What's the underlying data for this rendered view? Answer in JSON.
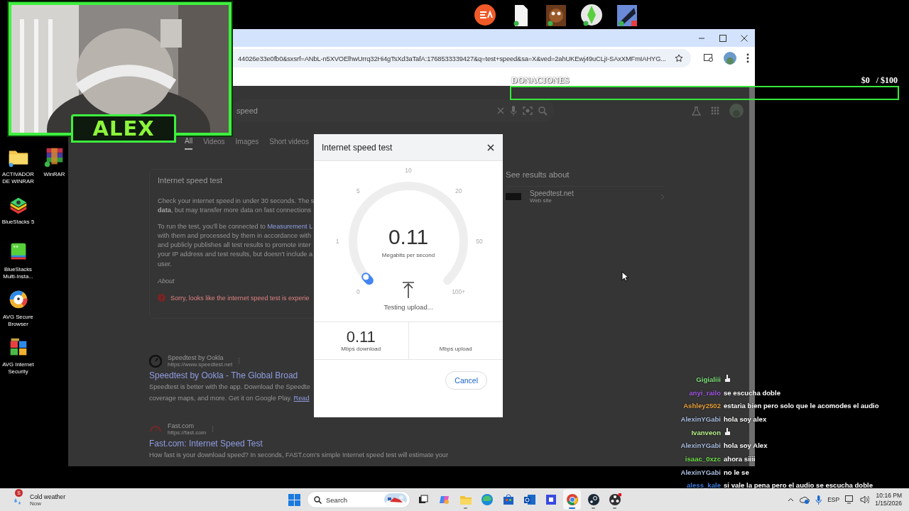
{
  "webcam": {
    "name": "ALEX"
  },
  "desktop_icons": [
    {
      "label": "ACTIVADOR DE WINRAR"
    },
    {
      "label": "WinRAR"
    },
    {
      "label": "BlueStacks 5"
    },
    {
      "label": "BlueStacks Multi-Insta..."
    },
    {
      "label": "AVG Secure Browser"
    },
    {
      "label": "AVG Internet Security"
    }
  ],
  "browser": {
    "url": "44026e33e0fb0&sxsrf=ANbL-n5XVOElhwUrrq32Hi4gTsXd3aTafA:1768533339427&q=test+speed&sa=X&ved=2ahUKEwj49uCLjI-SAxXMFmIAHYG...",
    "search_query": "speed",
    "tabs": [
      {
        "label": "All",
        "selected": true
      },
      {
        "label": "Videos",
        "selected": false
      },
      {
        "label": "Images",
        "selected": false
      },
      {
        "label": "Short videos",
        "selected": false
      }
    ],
    "card": {
      "title": "Internet speed test",
      "paragraphs": [
        [
          {
            "text": "Check your internet speed in under 30 seconds. The s"
          },
          {
            "text": "**data**, but may transfer more data on fast connections"
          }
        ],
        [
          {
            "text": "To run the test, you'll be connected to ",
            "link": "Measurement L"
          },
          {
            "text": "with them and processed by them in accordance with"
          },
          {
            "text": "and publicly publishes all test results to promote inter"
          },
          {
            "text": "your IP address and test results, but doesn't include a"
          },
          {
            "text": "user."
          }
        ]
      ],
      "about": "About",
      "error": "Sorry, looks like the internet speed test is experie"
    },
    "results": [
      {
        "site": "Speedtest by Ookla",
        "url": "https://www.speedtest.net",
        "title": "Speedtest by Ookla - The Global Broad",
        "lines": [
          {
            "text": "Speedtest is better with the app. Download the Speedte"
          },
          {
            "text": "coverage maps, and more. Get it on Google Play. ",
            "link": "Read"
          }
        ]
      },
      {
        "site": "Fast.com",
        "url": "https://fast.com",
        "title": "Fast.com: Internet Speed Test",
        "lines": [
          {
            "text": "How fast is your download speed? In seconds, FAST.com's simple Internet speed test will estimate your"
          }
        ]
      }
    ],
    "side_panel": {
      "heading": "See results about",
      "item_title": "Speedtest.net",
      "item_subtitle": "Web site"
    }
  },
  "dialog": {
    "title": "Internet speed test",
    "gauge": {
      "ticks": [
        "0",
        "1",
        "5",
        "10",
        "20",
        "50",
        "100+"
      ],
      "reading": "0.11",
      "unit": "Megabits per second",
      "status": "Testing upload..."
    },
    "results": [
      {
        "value": "0.11",
        "label": "Mbps download"
      },
      {
        "label": "Mbps upload"
      }
    ],
    "cancel": "Cancel"
  },
  "donations": {
    "label": "DONACIONES",
    "raised": "$0",
    "goal": "/ $100"
  },
  "chat": [
    {
      "user": "Gigialiii",
      "color": "#7ee07a",
      "kind": "emote"
    },
    {
      "user": "anyi_railo",
      "color": "#a55be8",
      "kind": "text",
      "message": "se escucha doble"
    },
    {
      "user": "Ashley2502",
      "color": "#e8a23c",
      "kind": "text",
      "message": "estaria bien pero solo que le acomodes el audio"
    },
    {
      "user": "AlexinYGabi",
      "color": "#a9bde0",
      "kind": "text",
      "message": "hola soy alex"
    },
    {
      "user": "Ivanveon",
      "color": "#b6f08a",
      "kind": "emote"
    },
    {
      "user": "AlexinYGabi",
      "color": "#a9bde0",
      "kind": "text",
      "message": "hola soy Alex"
    },
    {
      "user": "isaac_0xzc",
      "color": "#6fe04a",
      "kind": "text",
      "message": "ahora siiii"
    },
    {
      "user": "AlexinYGabi",
      "color": "#a9bde0",
      "kind": "text",
      "message": "no le se"
    },
    {
      "user": "aless_kale",
      "color": "#3a78d8",
      "kind": "text",
      "message": "si vale la pena pero el audio se escucha doble"
    }
  ],
  "taskbar": {
    "weather": {
      "badge": "S",
      "title": "Cold weather",
      "subtitle": "Now"
    },
    "search_placeholder": "Search",
    "apps": [
      {
        "active": false,
        "running": false
      },
      {
        "active": false,
        "running": false
      },
      {
        "active": false,
        "running": true
      },
      {
        "active": false,
        "running": false
      },
      {
        "active": false,
        "running": false
      },
      {
        "active": false,
        "running": false
      },
      {
        "active": false,
        "running": false
      },
      {
        "active": true,
        "running": true
      },
      {
        "active": false,
        "running": true
      },
      {
        "active": false,
        "running": true
      }
    ],
    "language": "ESP",
    "time": "10:16 PM",
    "date": "1/15/2026"
  }
}
